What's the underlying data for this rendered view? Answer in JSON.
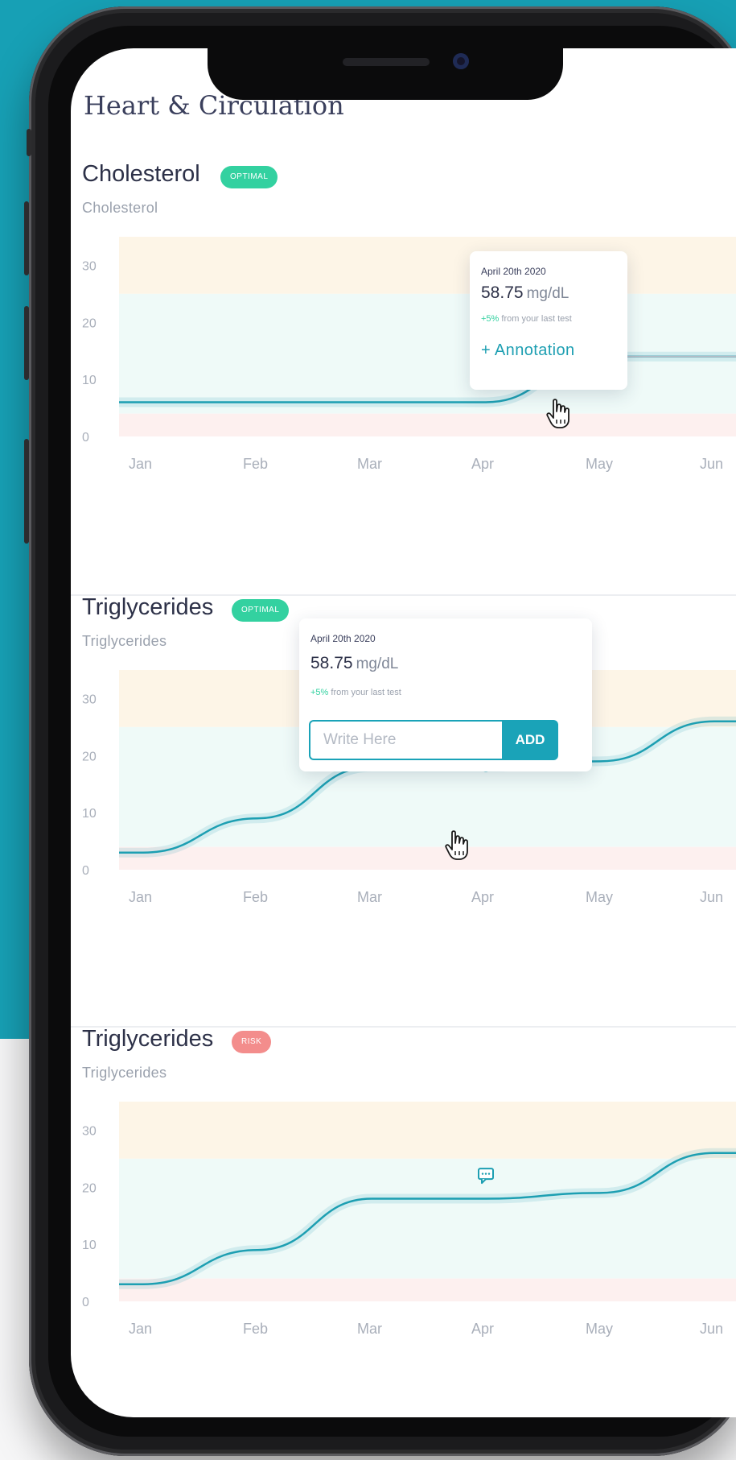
{
  "page": {
    "title": "Heart & Circulation"
  },
  "axis": {
    "y_ticks": [
      "30",
      "20",
      "10",
      "0"
    ],
    "months": [
      "Jan",
      "Feb",
      "Mar",
      "Apr",
      "May",
      "Jun"
    ]
  },
  "colors": {
    "teal_background": "#17a0b5",
    "line": "#1d9fb2",
    "band_high": "#fdf5e7",
    "band_normal": "#effaf8",
    "band_low": "#fdf0ef",
    "badge_optimal": "#33d1a0",
    "badge_risk": "#f38d8c"
  },
  "sections": [
    {
      "title": "Cholesterol",
      "badge": "OPTIMAL",
      "badge_status": "optimal",
      "subtitle": "Cholesterol",
      "tooltip": {
        "date": "April 20th 2020",
        "value": "58.75",
        "unit": "mg/dL",
        "change_pct": "+5%",
        "change_text": "from your last test",
        "annotation_label": "+ Annotation"
      }
    },
    {
      "title": "Triglycerides",
      "badge": "OPTIMAL",
      "badge_status": "optimal",
      "subtitle": "Triglycerides",
      "tooltip": {
        "date": "April 20th 2020",
        "value": "58.75",
        "unit": "mg/dL",
        "change_pct": "+5%",
        "change_text": "from your last test",
        "input_placeholder": "Write Here",
        "add_label": "ADD"
      }
    },
    {
      "title": "Triglycerides",
      "badge": "RISK",
      "badge_status": "risk",
      "subtitle": "Triglycerides",
      "annotation_marker": "comment-icon"
    }
  ],
  "chart_data": [
    {
      "type": "line",
      "x": [
        "Jan",
        "Feb",
        "Mar",
        "Apr",
        "May",
        "Jun"
      ],
      "series": [
        {
          "values": [
            6,
            6,
            6,
            6,
            14,
            14
          ]
        }
      ],
      "ylim": [
        0,
        35
      ],
      "bands": {
        "high_above": 25,
        "low_below": 4
      },
      "highlight": {
        "x": "May",
        "y": 14
      }
    },
    {
      "type": "line",
      "x": [
        "Jan",
        "Feb",
        "Mar",
        "Apr",
        "May",
        "Jun"
      ],
      "series": [
        {
          "values": [
            3,
            9,
            18,
            18,
            19,
            26
          ]
        }
      ],
      "ylim": [
        0,
        35
      ],
      "bands": {
        "high_above": 25,
        "low_below": 4
      },
      "highlight": {
        "x": "Apr",
        "y": 18
      }
    },
    {
      "type": "line",
      "x": [
        "Jan",
        "Feb",
        "Mar",
        "Apr",
        "May",
        "Jun"
      ],
      "series": [
        {
          "values": [
            3,
            9,
            18,
            18,
            19,
            26
          ]
        }
      ],
      "ylim": [
        0,
        35
      ],
      "bands": {
        "high_above": 25,
        "low_below": 4
      },
      "annotation": {
        "x": "Apr",
        "y": 22
      }
    }
  ]
}
